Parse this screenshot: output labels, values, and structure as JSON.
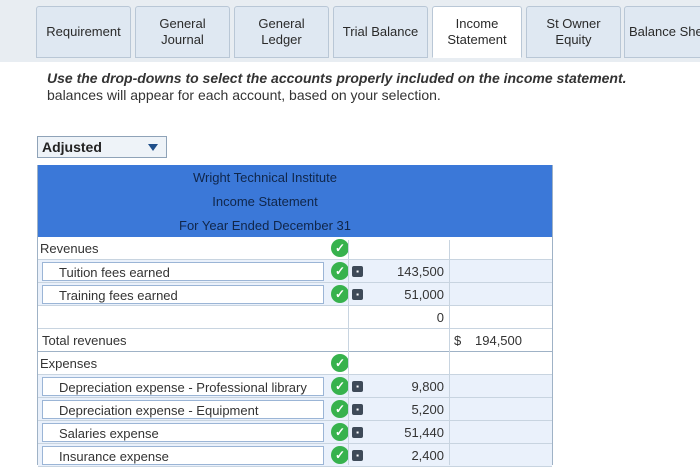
{
  "tabs": [
    {
      "label": "Requirement",
      "active": false
    },
    {
      "label": "General\nJournal",
      "active": false
    },
    {
      "label": "General\nLedger",
      "active": false
    },
    {
      "label": "Trial Balance",
      "active": false
    },
    {
      "label": "Income\nStatement",
      "active": true
    },
    {
      "label": "St Owner\nEquity",
      "active": false
    },
    {
      "label": "Balance She",
      "active": false
    }
  ],
  "instruction": {
    "emphasis": "Use the drop-downs to select the accounts properly included on the income statement.",
    "rest": "balances will appear for each account, based on your selection."
  },
  "dropdown": {
    "selected": "Adjusted"
  },
  "statement": {
    "company": "Wright Technical Institute",
    "title": "Income Statement",
    "period": "For Year Ended December 31",
    "rows": [
      {
        "account": "Revenues",
        "amount": "",
        "total_currency": "",
        "total": ""
      },
      {
        "account": "Tuition fees earned",
        "amount": "143,500",
        "total_currency": "",
        "total": ""
      },
      {
        "account": "Training fees earned",
        "amount": "51,000",
        "total_currency": "",
        "total": ""
      },
      {
        "account": "",
        "amount": "0",
        "total_currency": "",
        "total": ""
      },
      {
        "account": "Total revenues",
        "amount": "",
        "total_currency": "$",
        "total": "194,500"
      },
      {
        "account": "Expenses",
        "amount": "",
        "total_currency": "",
        "total": ""
      },
      {
        "account": "Depreciation expense - Professional library",
        "amount": "9,800",
        "total_currency": "",
        "total": ""
      },
      {
        "account": "Depreciation expense - Equipment",
        "amount": "5,200",
        "total_currency": "",
        "total": ""
      },
      {
        "account": "Salaries expense",
        "amount": "51,440",
        "total_currency": "",
        "total": ""
      },
      {
        "account": "Insurance expense",
        "amount": "2,400",
        "total_currency": "",
        "total": ""
      }
    ]
  },
  "colors": {
    "header_blue": "#3b78d8",
    "check_green": "#37b24d"
  }
}
